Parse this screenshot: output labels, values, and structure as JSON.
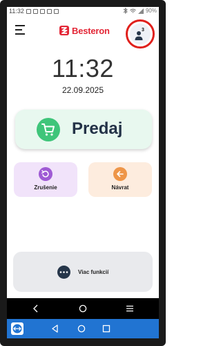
{
  "status_bar": {
    "time": "11:32",
    "battery": "90%"
  },
  "header": {
    "brand_name": "Besteron",
    "user_count": "3"
  },
  "clock": {
    "time": "11:32",
    "date": "22.09.2025"
  },
  "actions": {
    "sale_label": "Predaj",
    "cancel_label": "Zrušenie",
    "return_label": "Návrat",
    "more_label": "Viac funkcií"
  },
  "colors": {
    "brand": "#e32636",
    "sale_bg": "#e8f8ef",
    "sale_icon": "#3fc57a",
    "cancel_bg": "#f1e3fa",
    "cancel_icon": "#9f5ad4",
    "return_bg": "#fdecde",
    "return_icon": "#ee9649",
    "highlight_ring": "#e0201c",
    "remote_bar": "#2174d2"
  },
  "icons": {
    "menu": "hamburger-icon",
    "brand": "besteron-logo",
    "user": "user-icon",
    "sale": "cart-icon",
    "cancel": "undo-icon",
    "return": "arrow-left-icon",
    "more": "more-horizontal-icon"
  }
}
